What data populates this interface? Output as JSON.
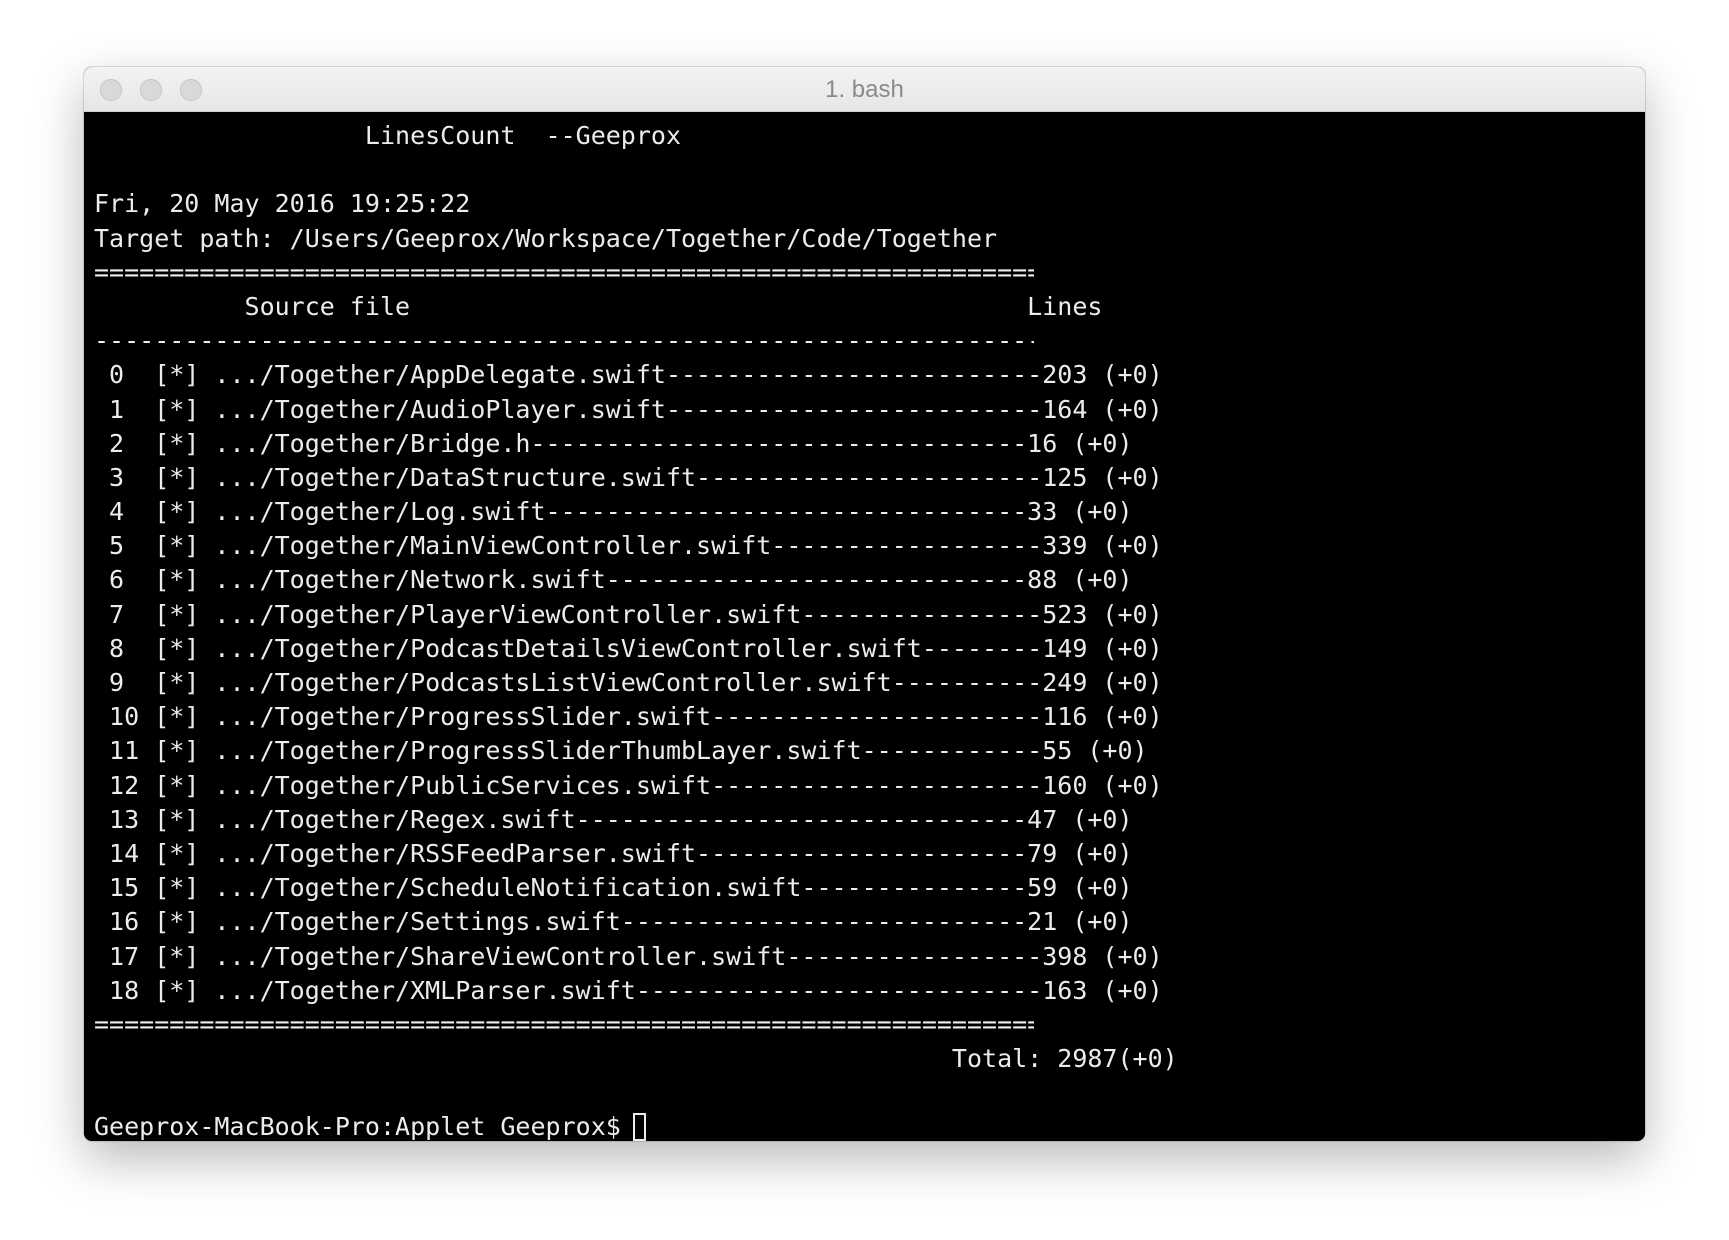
{
  "window": {
    "title": "1. bash"
  },
  "terminal": {
    "header": "                  LinesCount  --Geeprox",
    "date_line": "Fri, 20 May 2016 19:25:22",
    "target_line": "Target path: /Users/Geeprox/Workspace/Together/Code/Together",
    "rule_double": "====================================================================",
    "column_header": "          Source file                                         Lines",
    "rule_single": "--------------------------------------------------------------------",
    "rows": [
      " 0  [*] .../Together/AppDelegate.swift-------------------------203 (+0)",
      " 1  [*] .../Together/AudioPlayer.swift-------------------------164 (+0)",
      " 2  [*] .../Together/Bridge.h---------------------------------16 (+0)",
      " 3  [*] .../Together/DataStructure.swift-----------------------125 (+0)",
      " 4  [*] .../Together/Log.swift--------------------------------33 (+0)",
      " 5  [*] .../Together/MainViewController.swift------------------339 (+0)",
      " 6  [*] .../Together/Network.swift----------------------------88 (+0)",
      " 7  [*] .../Together/PlayerViewController.swift----------------523 (+0)",
      " 8  [*] .../Together/PodcastDetailsViewController.swift--------149 (+0)",
      " 9  [*] .../Together/PodcastsListViewController.swift----------249 (+0)",
      " 10 [*] .../Together/ProgressSlider.swift----------------------116 (+0)",
      " 11 [*] .../Together/ProgressSliderThumbLayer.swift------------55 (+0)",
      " 12 [*] .../Together/PublicServices.swift----------------------160 (+0)",
      " 13 [*] .../Together/Regex.swift------------------------------47 (+0)",
      " 14 [*] .../Together/RSSFeedParser.swift----------------------79 (+0)",
      " 15 [*] .../Together/ScheduleNotification.swift---------------59 (+0)",
      " 16 [*] .../Together/Settings.swift---------------------------21 (+0)",
      " 17 [*] .../Together/ShareViewController.swift-----------------398 (+0)",
      " 18 [*] .../Together/XMLParser.swift---------------------------163 (+0)"
    ],
    "total_line": "                                                         Total: 2987(+0)",
    "prompt": "Geeprox-MacBook-Pro:Applet Geeprox$"
  }
}
